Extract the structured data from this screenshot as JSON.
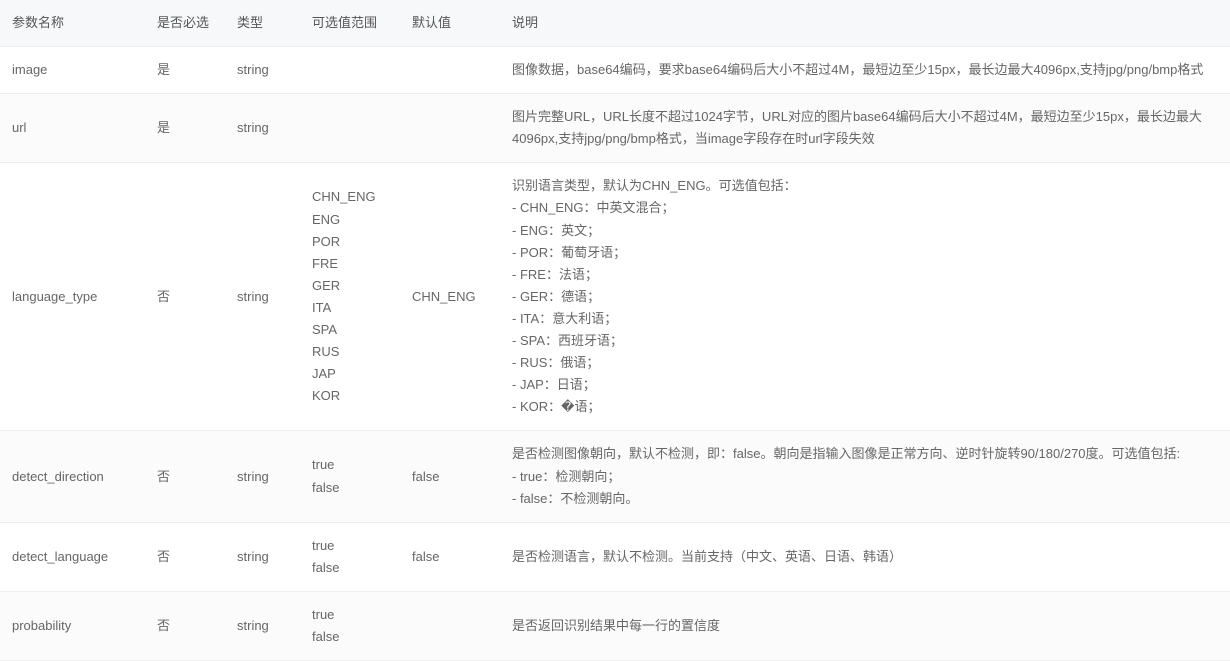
{
  "headers": {
    "name": "参数名称",
    "required": "是否必选",
    "type": "类型",
    "values": "可选值范围",
    "default": "默认值",
    "description": "说明"
  },
  "rows": [
    {
      "name": "image",
      "required": "是",
      "type": "string",
      "values": "",
      "default": "",
      "description": "图像数据，base64编码，要求base64编码后大小不超过4M，最短边至少15px，最长边最大4096px,支持jpg/png/bmp格式"
    },
    {
      "name": "url",
      "required": "是",
      "type": "string",
      "values": "",
      "default": "",
      "description": "图片完整URL，URL长度不超过1024字节，URL对应的图片base64编码后大小不超过4M，最短边至少15px，最长边最大4096px,支持jpg/png/bmp格式，当image字段存在时url字段失效"
    },
    {
      "name": "language_type",
      "required": "否",
      "type": "string",
      "values": "CHN_ENG\nENG\nPOR\nFRE\nGER\nITA\nSPA\nRUS\nJAP\nKOR",
      "default": "CHN_ENG",
      "description": "识别语言类型，默认为CHN_ENG。可选值包括：\n- CHN_ENG：中英文混合；\n- ENG：英文；\n- POR：葡萄牙语；\n- FRE：法语；\n- GER：德语；\n- ITA：意大利语；\n- SPA：西班牙语；\n- RUS：俄语；\n- JAP：日语；\n- KOR：�语；"
    },
    {
      "name": "detect_direction",
      "required": "否",
      "type": "string",
      "values": "true\nfalse",
      "default": "false",
      "description": "是否检测图像朝向，默认不检测，即：false。朝向是指输入图像是正常方向、逆时针旋转90/180/270度。可选值包括:\n- true：检测朝向；\n- false：不检测朝向。"
    },
    {
      "name": "detect_language",
      "required": "否",
      "type": "string",
      "values": "true\nfalse",
      "default": "false",
      "description": "是否检测语言，默认不检测。当前支持（中文、英语、日语、韩语）"
    },
    {
      "name": "probability",
      "required": "否",
      "type": "string",
      "values": "true\nfalse",
      "default": "",
      "description": "是否返回识别结果中每一行的置信度"
    }
  ]
}
